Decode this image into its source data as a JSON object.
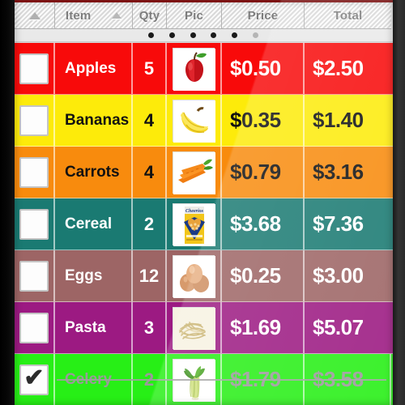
{
  "header": {
    "columns": [
      {
        "label": "",
        "name": "sort-handle",
        "icon": "triangle-up-icon"
      },
      {
        "label": "Item",
        "name": "item"
      },
      {
        "label": "Qty",
        "name": "qty"
      },
      {
        "label": "Pic",
        "name": "pic"
      },
      {
        "label": "Price",
        "name": "price"
      },
      {
        "label": "Total",
        "name": "total"
      }
    ],
    "sort_icon": "triangle-up-icon"
  },
  "pagination": {
    "dots": 6,
    "active_index": 5,
    "active_color": "#b5b5b5",
    "inactive_color": "#1a1a1a"
  },
  "rows": [
    {
      "item": "Apples",
      "qty": "5",
      "price": "$0.50",
      "total": "$2.50",
      "pic": "apple-thumbnail",
      "checked": false,
      "done": false,
      "bg": "#f80a0a",
      "text": "#ffffff"
    },
    {
      "item": "Bananas",
      "qty": "4",
      "price": "$0.35",
      "total": "$1.40",
      "pic": "bananas-thumbnail",
      "checked": false,
      "done": false,
      "bg": "#fdeb0a",
      "text": "#111111"
    },
    {
      "item": "Carrots",
      "qty": "4",
      "price": "$0.79",
      "total": "$3.16",
      "pic": "carrots-thumbnail",
      "checked": false,
      "done": false,
      "bg": "#f88b0d",
      "text": "#111111"
    },
    {
      "item": "Cereal",
      "qty": "2",
      "price": "$3.68",
      "total": "$7.36",
      "pic": "cereal-box-thumbnail",
      "checked": false,
      "done": false,
      "bg": "#1a7a72",
      "text": "#ffffff"
    },
    {
      "item": "Eggs",
      "qty": "12",
      "price": "$0.25",
      "total": "$3.00",
      "pic": "eggs-thumbnail",
      "checked": false,
      "done": false,
      "bg": "#9d6565",
      "text": "#ffffff"
    },
    {
      "item": "Pasta",
      "qty": "3",
      "price": "$1.69",
      "total": "$5.07",
      "pic": "pasta-thumbnail",
      "checked": false,
      "done": false,
      "bg": "#9c1a82",
      "text": "#ffffff"
    },
    {
      "item": "Celery",
      "qty": "2",
      "price": "$1.79",
      "total": "$3.58",
      "pic": "celery-thumbnail",
      "checked": true,
      "done": true,
      "bg": "#27ef16",
      "text": "#9a9a9a"
    }
  ],
  "checkmark_glyph": "✔"
}
